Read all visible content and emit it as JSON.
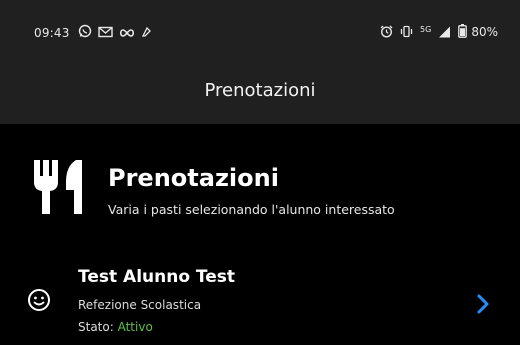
{
  "status_bar": {
    "time": "09:43",
    "battery": "80%",
    "network": "5G",
    "left_icons": [
      "whatsapp-icon",
      "gmail-icon",
      "infinity-icon",
      "notification-icon"
    ],
    "right_icons": [
      "alarm-icon",
      "vibrate-icon",
      "network-icon",
      "signal-icon",
      "battery-icon"
    ]
  },
  "app_bar": {
    "title": "Prenotazioni"
  },
  "header": {
    "icon": "cutlery-icon",
    "title": "Prenotazioni",
    "subtitle": "Varia i pasti selezionando l'alunno interessato"
  },
  "student": {
    "name": "Test Alunno Test",
    "service": "Refezione Scolastica",
    "status_label": "Stato:",
    "status_value": "Attivo",
    "icon": "smiley-icon",
    "chevron_icon": "chevron-right-icon"
  },
  "colors": {
    "bar_bg": "#202020",
    "page_bg": "#000000",
    "status_active": "#5cc23b",
    "chevron": "#1e90ff"
  }
}
